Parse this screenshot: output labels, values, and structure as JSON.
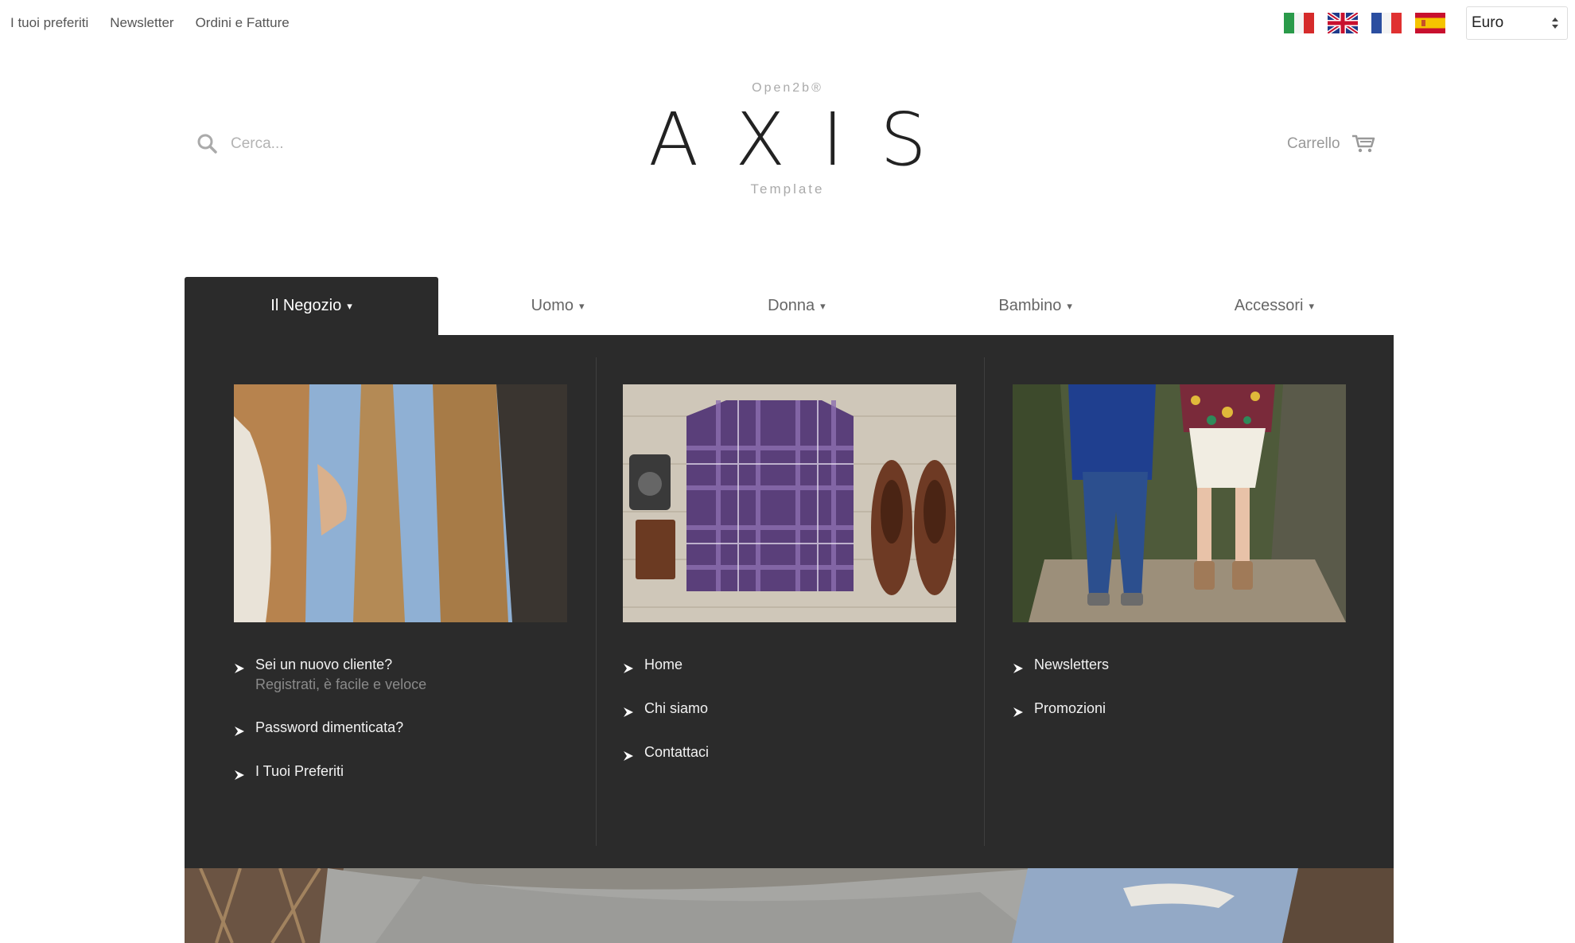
{
  "topbar": {
    "links": [
      "I tuoi preferiti",
      "Newsletter",
      "Ordini e Fatture"
    ],
    "flags": [
      "italy-flag",
      "uk-flag",
      "france-flag",
      "spain-flag"
    ],
    "currency": "Euro"
  },
  "header": {
    "search_placeholder": "Cerca...",
    "logo_top": "Open2b®",
    "logo_main": "AXIS",
    "logo_bottom": "Template",
    "cart_label": "Carrello"
  },
  "nav": {
    "items": [
      "Il Negozio",
      "Uomo",
      "Donna",
      "Bambino",
      "Accessori"
    ],
    "caret": "▾"
  },
  "mega": {
    "col1": {
      "link1_title": "Sei un nuovo cliente?",
      "link1_sub": "Registrati, è facile e veloce",
      "link2": "Password dimenticata?",
      "link3": "I Tuoi Preferiti"
    },
    "col2": {
      "link1": "Home",
      "link2": "Chi siamo",
      "link3": "Contattaci"
    },
    "col3": {
      "link1": "Newsletters",
      "link2": "Promozioni"
    }
  },
  "colors": {
    "menu_bg": "#2b2b2b",
    "text_muted": "#8a8a8a"
  }
}
